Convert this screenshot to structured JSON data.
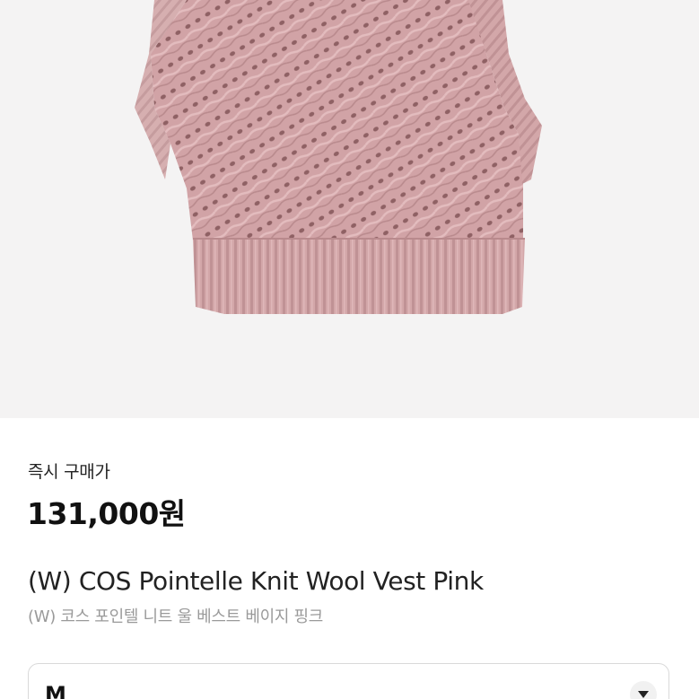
{
  "product": {
    "price_label": "즉시 구매가",
    "price": "131,000원",
    "title": "(W) COS Pointelle Knit Wool Vest Pink",
    "subtitle": "(W) 코스 포인텔 니트 울 베스트 베이지 핑크",
    "image_icon": "knit-vest-photo",
    "accent_color": "#d4a5a7"
  },
  "size_select": {
    "value": "M",
    "icon": "chevron-down-icon"
  }
}
